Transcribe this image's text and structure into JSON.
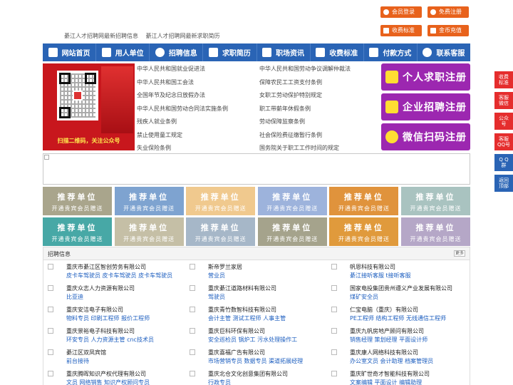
{
  "top_buttons": {
    "login": "会员登录",
    "register": "免费注册",
    "fees": "收费标准",
    "recharge": "金币充值"
  },
  "top_links": [
    "綦江人才招聘网最新招聘信息",
    "綦江人才招聘网最新求职简历"
  ],
  "nav": [
    "网站首页",
    "用人单位",
    "招聘信息",
    "求职简历",
    "职场资讯",
    "收费标准",
    "付款方式",
    "联系客服"
  ],
  "qr": {
    "caption": "扫描二维码，关注公众号"
  },
  "laws": [
    [
      "中华人民共和国就业促进法",
      "中华人民共和国劳动争议调解仲裁法"
    ],
    [
      "中华人民共和国工会法",
      "保障农民工工资支付条例"
    ],
    [
      "全国年节及纪念日放假办法",
      "女职工劳动保护特别规定"
    ],
    [
      "中华人民共和国劳动合同法实施条例",
      "职工带薪年休假条例"
    ],
    [
      "残疾人就业条例",
      "劳动保障监察条例"
    ],
    [
      "禁止使用童工规定",
      "社会保险费征缴暂行条例"
    ],
    [
      "失业保险条例",
      "国务院关于职工工作时间的规定"
    ]
  ],
  "register": {
    "personal": "个人求职注册",
    "company": "企业招聘注册",
    "wechat": "微信扫码注册"
  },
  "side_float": [
    [
      "收费",
      "标准"
    ],
    [
      "客服",
      "微信"
    ],
    [
      "公众",
      "号"
    ],
    [
      "客服",
      "QQ号"
    ],
    [
      "Q Q",
      "群"
    ],
    [
      "返回",
      "顶部"
    ]
  ],
  "recommend": {
    "title": "推荐单位",
    "subtitle": "开通贵宾会员赠送",
    "colors": [
      "#a9a58c",
      "#7ea3d0",
      "#f0c98e",
      "#9db3dc",
      "#e0933c",
      "#a9c3c0",
      "#47a8a6",
      "#c5bfa6",
      "#a6b7c8",
      "#a5a38c",
      "#e09a3c",
      "#b5a7c7"
    ]
  },
  "jobs": {
    "title": "招聘信息",
    "more": "更多",
    "entries": [
      {
        "company": "重庆市綦江区智创劳务有限公司",
        "positions": "皮卡车驾驶员 皮卡车驾驶员 皮卡车驾驶员"
      },
      {
        "company": "斯帝罗兰家居",
        "positions": "营业员"
      },
      {
        "company": "帆恩科技有限公司",
        "positions": "綦江接听客服 t接听客服"
      },
      {
        "company": "重庆众志人力资源有限公司",
        "positions": "比亚迪"
      },
      {
        "company": "重庆綦江道路材料有限公司",
        "positions": "驾驶员"
      },
      {
        "company": "国家电投集团贵州遵义产业发展有限公司",
        "positions": "煤矿安全员"
      },
      {
        "company": "重庆安洁电子有限公司",
        "positions": "物料专员 印刷工程师 报价工程师"
      },
      {
        "company": "重庆青竹数智科技有限公司",
        "positions": "会计主管 测试工程师 人事主管"
      },
      {
        "company": "仁宝电脑（重庆）有限公司",
        "positions": "PE工程师 结构工程师 无线通信工程师"
      },
      {
        "company": "重庆景裕电子科技有限公司",
        "positions": "环安专员 人力资源主管 cnc技术员"
      },
      {
        "company": "重庆巨科环保有限公司",
        "positions": "安全巡检员 锅炉工 污水处理操作工"
      },
      {
        "company": "重庆九帆房地产顾问有限公司",
        "positions": "销售经理 策划经理 平面设计师"
      },
      {
        "company": "綦江区双凤宾馆",
        "positions": "前台接待"
      },
      {
        "company": "重庆喜福广告有限公司",
        "positions": "市场营销专员 数据专员 渠道拓展经理"
      },
      {
        "company": "重庆康人网络科技有限公司",
        "positions": "办公室文员 会计助理 档案管理员"
      },
      {
        "company": "重庆腾晖知识产权代理有限公司",
        "positions": "文员 网络销售 知识产权顾问专员"
      },
      {
        "company": "重庆北仓文化创意集团有限公司",
        "positions": "行政专员"
      },
      {
        "company": "重庆旷世奇才智能科技有限公司",
        "positions": "文案编辑 平面设计 编辑助理"
      }
    ]
  }
}
